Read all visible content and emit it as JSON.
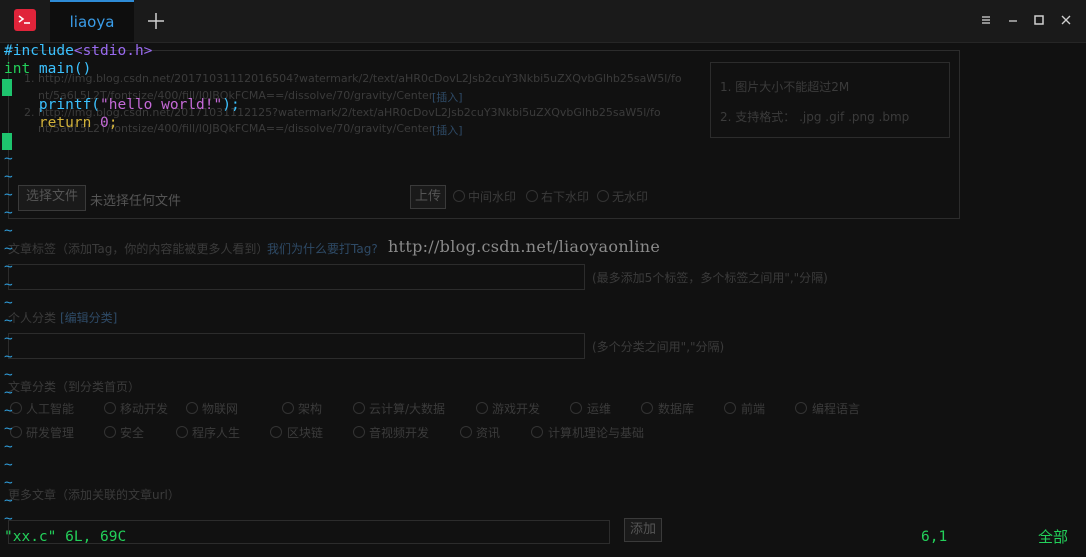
{
  "tab": {
    "label": "liaoya"
  },
  "editor": {
    "lines": [
      {
        "parts": [
          "#include",
          "<stdio.h>"
        ]
      },
      {
        "parts": [
          "int",
          " main()"
        ]
      },
      {
        "parts": [
          "    printf(",
          "\"hello world!\"",
          ");"
        ]
      },
      {
        "parts": [
          "    return ",
          "0",
          ";"
        ]
      }
    ],
    "tilde": "~"
  },
  "status": {
    "file_info": "\"xx.c\" 6L, 69C",
    "position": "6,1",
    "scroll": "全部"
  },
  "watermark": "http://blog.csdn.net/liaoyaonline",
  "background_page": {
    "list_item_1a": "1.  http://img.blog.csdn.net/20171031112016504?watermark/2/text/aHR0cDovL2Jsb2cuY3Nkbi5uZXQvbGlhb25saW5l/fo",
    "list_item_1b": "nt/5a6L5L2T/fontsize/400/fill/I0JBQkFCMA==/dissolve/70/gravity/Center",
    "list_item_2a": "2.  http://img.blog.csdn.net/20171031112125?watermark/2/text/aHR0cDovL2Jsb2cuY3Nkbi5uZXQvbGlhb25saW5l/fo",
    "list_item_2b": "nt/5a6L5L2T/fontsize/400/fill/I0JBQkFCMA==/dissolve/70/gravity/Center",
    "insert_link": "[插入]",
    "hint_size": "1.   图片大小不能超过2M",
    "hint_format": "2.   支持格式： .jpg .gif .png .bmp",
    "choose_file": "选择文件",
    "no_file": "未选择任何文件",
    "upload": "上传",
    "wm_center": "中间水印",
    "wm_bottom_right": "右下水印",
    "wm_none": "无水印",
    "tags_label": "文章标签（添加Tag，你的内容能被更多人看到）",
    "tags_why": "我们为什么要打Tag?",
    "tags_hint": "(最多添加5个标签，多个标签之间用\",\"分隔)",
    "personal_cat": "个人分类",
    "edit_cat": "[编辑分类]",
    "cat_hint": "(多个分类之间用\",\"分隔)",
    "article_cat": "文章分类（到分类首页）",
    "categories_row1": [
      "人工智能",
      "移动开发",
      "物联网",
      "架构",
      "云计算/大数据",
      "游戏开发",
      "运维",
      "数据库",
      "前端",
      "编程语言"
    ],
    "categories_row2": [
      "研发管理",
      "安全",
      "程序人生",
      "区块链",
      "音视频开发",
      "资讯",
      "计算机理论与基础"
    ],
    "related_label": "更多文章（添加关联的文章url）",
    "add_button": "添加"
  },
  "colors": {
    "accent": "#2e8bd6",
    "status_green": "#23d05a",
    "cursor": "#1ec46e"
  },
  "icons": {
    "app": "terminal-icon",
    "add": "plus-icon",
    "menu": "menu-icon",
    "minimize": "minimize-icon",
    "maximize": "maximize-icon",
    "close": "close-icon"
  }
}
